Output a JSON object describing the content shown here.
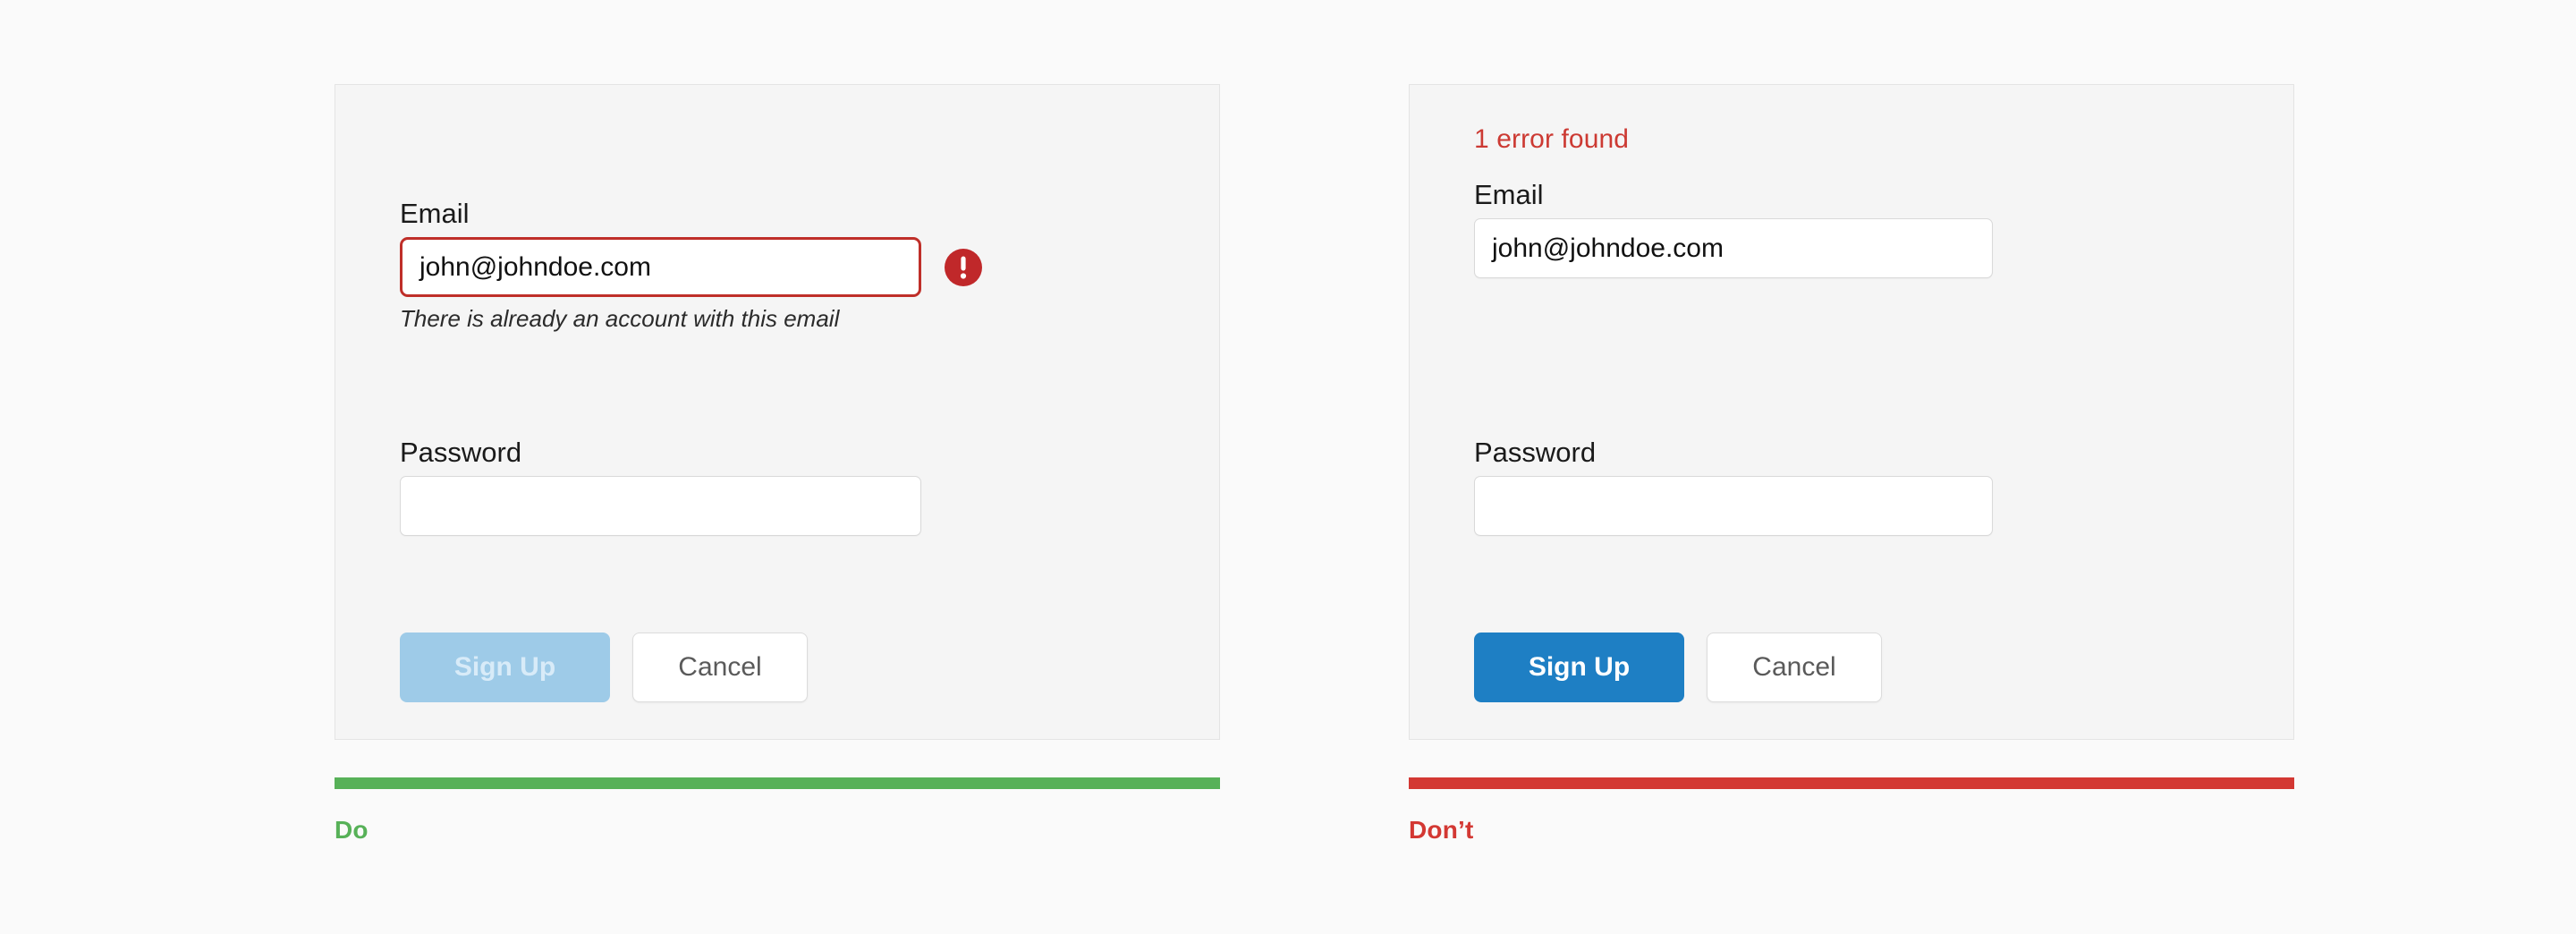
{
  "page": {
    "background_color": "#fafafa"
  },
  "colors": {
    "do_green": "#57b158",
    "dont_red": "#d33833",
    "error_red": "#cc3a33",
    "invalid_border": "#bf2f29",
    "primary_blue": "#1e7fc4",
    "primary_blue_disabled": "#9ecbe8",
    "panel_background": "#f5f5f5",
    "panel_border": "#e4e4e4"
  },
  "examples": [
    {
      "verdict": "Do",
      "verdict_label": "Do",
      "verdict_color": "#57b158",
      "form": {
        "error_summary": "",
        "email": {
          "label": "Email",
          "value": "john@johndoe.com",
          "placeholder": "",
          "invalid": true,
          "alert_icon": "exclamation-circle-icon",
          "helper_text": "There is already an account with this email"
        },
        "password": {
          "label": "Password",
          "value": "",
          "placeholder": "",
          "invalid": false,
          "helper_text": ""
        },
        "submit_label": "Sign Up",
        "submit_disabled": true,
        "cancel_label": "Cancel"
      }
    },
    {
      "verdict": "Don't",
      "verdict_label": "Don’t",
      "verdict_color": "#d33833",
      "form": {
        "error_summary": "1 error found",
        "email": {
          "label": "Email",
          "value": "john@johndoe.com",
          "placeholder": "",
          "invalid": false,
          "alert_icon": "",
          "helper_text": ""
        },
        "password": {
          "label": "Password",
          "value": "",
          "placeholder": "",
          "invalid": false,
          "helper_text": ""
        },
        "submit_label": "Sign Up",
        "submit_disabled": false,
        "cancel_label": "Cancel"
      }
    }
  ]
}
